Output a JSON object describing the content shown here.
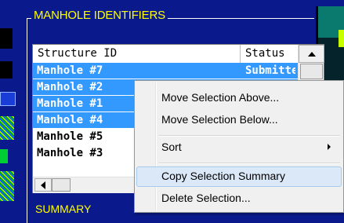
{
  "group": {
    "title": "MANHOLE IDENTIFIERS"
  },
  "list": {
    "columns": [
      "Structure ID",
      "Status"
    ],
    "rows": [
      {
        "id": "Manhole #7",
        "status": "Submitted",
        "selected": true
      },
      {
        "id": "Manhole #2",
        "status": "",
        "selected": true
      },
      {
        "id": "Manhole #1",
        "status": "",
        "selected": true
      },
      {
        "id": "Manhole #4",
        "status": "",
        "selected": true
      },
      {
        "id": "Manhole #5",
        "status": "",
        "selected": false
      },
      {
        "id": "Manhole #3",
        "status": "",
        "selected": false
      }
    ]
  },
  "summary": {
    "title": "SUMMARY"
  },
  "context_menu": {
    "items": [
      {
        "label": "Move Selection Above...",
        "submenu": false,
        "highlighted": false
      },
      {
        "label": "Move Selection Below...",
        "submenu": false,
        "highlighted": false
      },
      {
        "label": "Sort",
        "submenu": true,
        "highlighted": false
      },
      {
        "label": "Copy Selection Summary",
        "submenu": false,
        "highlighted": true
      },
      {
        "label": "Delete Selection...",
        "submenu": false,
        "highlighted": false
      }
    ]
  },
  "colors": {
    "background": "#0a1a8c",
    "title_text": "#ffff00",
    "selection": "#3399ff",
    "menu_highlight": "#dbe8f7"
  }
}
